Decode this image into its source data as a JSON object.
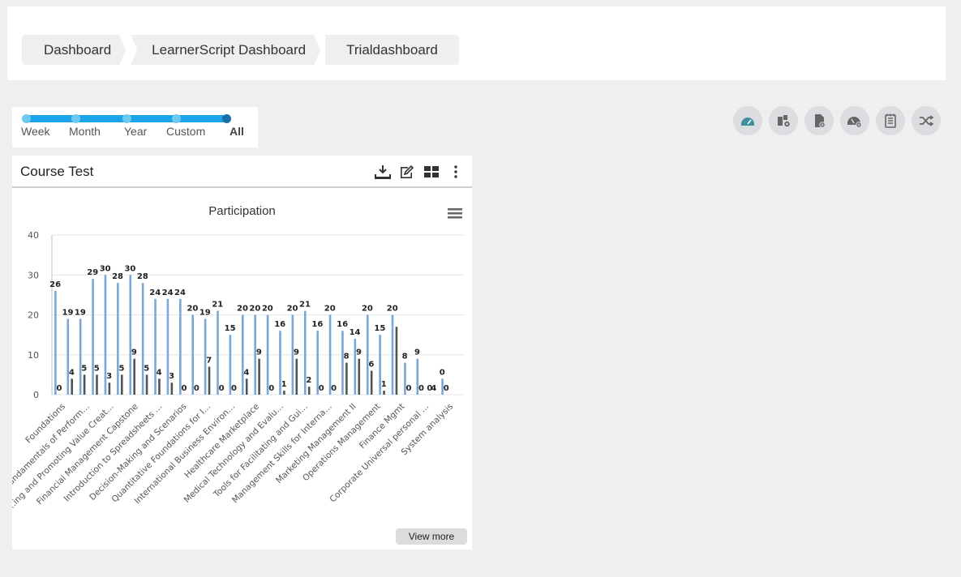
{
  "breadcrumb": {
    "items": [
      {
        "label": "Dashboard"
      },
      {
        "label": "LearnerScript Dashboard"
      },
      {
        "label": "Trialdashboard"
      }
    ]
  },
  "range_filter": {
    "options": [
      "Week",
      "Month",
      "Year",
      "Custom",
      "All"
    ],
    "selected": "All"
  },
  "toolbar": {
    "icons": [
      "dashboard-gauge-icon",
      "add-widget-icon",
      "add-report-icon",
      "add-dashboard-icon",
      "schedule-notes-icon",
      "shuffle-icon"
    ],
    "active_color": "#3e8fa0"
  },
  "report": {
    "title": "Course Test",
    "view_more": "View more"
  },
  "chart_data": {
    "type": "bar",
    "title": "Participation",
    "ylim": [
      0,
      40
    ],
    "yticks": [
      0,
      10,
      20,
      30,
      40
    ],
    "grid": true,
    "colors": [
      "#7ba7d7",
      "#4d5558"
    ],
    "category_labels": [
      "Foundations",
      "Fundamentals of Perform…",
      "...ing and Promoting Value Creat…",
      "Financial Management Capstone",
      "Introduction to Spreadsheets …",
      "Decision-Making and Scenarios",
      "Quantitative Foundations for I…",
      "International Business Environ…",
      "Healthcare Marketplace",
      "Medical Technology and Evalu…",
      "Tools for Facilitating and Gui…",
      "Management Skills for Interna…",
      "Marketing Management II",
      "Operations Management",
      "Finance Mgmt",
      "Corporate Universal personal …",
      "System analysis"
    ],
    "series": [
      {
        "values": [
          26,
          19,
          19,
          29,
          30,
          28,
          30,
          28,
          24,
          24,
          24,
          20,
          19,
          21,
          15,
          20,
          20,
          20,
          16,
          20,
          21,
          16,
          20,
          16,
          14,
          20,
          15,
          20,
          8,
          9,
          0,
          4,
          0
        ]
      },
      {
        "values": [
          0,
          4,
          5,
          5,
          3,
          5,
          9,
          5,
          4,
          3,
          0,
          0,
          7,
          0,
          0,
          4,
          9,
          0,
          1,
          9,
          2,
          0,
          0,
          8,
          9,
          6,
          1,
          17,
          0,
          0,
          0,
          0,
          0
        ]
      }
    ],
    "data_labels": [
      "26",
      "0",
      "19",
      "4",
      "19",
      "5",
      "29",
      "5",
      "30",
      "3",
      "28",
      "5",
      "30",
      "9",
      "28",
      "5",
      "24",
      "4",
      "24",
      "3",
      "24",
      "0",
      "20",
      "0",
      "19",
      "7",
      "21",
      "0",
      "15",
      "0",
      "20",
      "4",
      "20",
      "9",
      "20",
      "0",
      "16",
      "1",
      "20",
      "9",
      "21",
      "2",
      "16",
      "0",
      "20",
      "0",
      "16",
      "8",
      "14",
      "9",
      "20",
      "6",
      "15",
      "1",
      "20",
      "",
      "8",
      "0",
      "9",
      "0",
      "0",
      "4",
      "0",
      "0"
    ]
  }
}
